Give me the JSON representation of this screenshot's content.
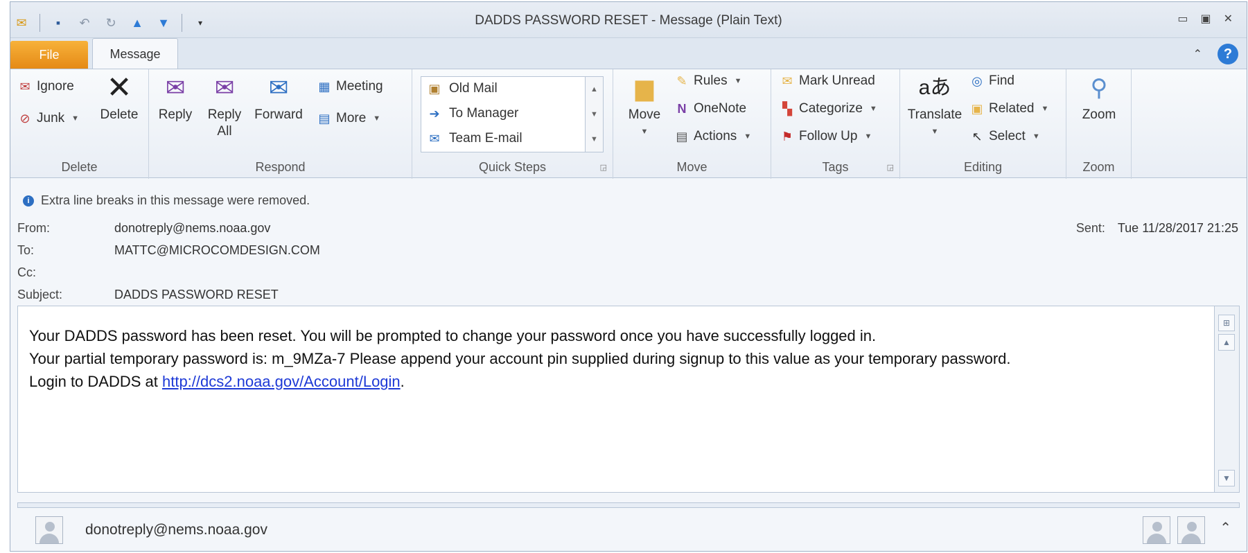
{
  "window": {
    "title": "DADDS PASSWORD RESET  -  Message (Plain Text)",
    "quick_access_icons": [
      "mail-icon",
      "save-icon",
      "undo-icon",
      "redo-icon",
      "previous-item-icon",
      "next-item-icon",
      "customize-qat-icon"
    ]
  },
  "tabs": {
    "file": "File",
    "message": "Message"
  },
  "ribbon": {
    "delete": {
      "label": "Delete",
      "ignore": "Ignore",
      "junk": "Junk",
      "delete_btn": "Delete"
    },
    "respond": {
      "label": "Respond",
      "reply": "Reply",
      "reply_all": "Reply\nAll",
      "forward": "Forward",
      "meeting": "Meeting",
      "more": "More"
    },
    "quick_steps": {
      "label": "Quick Steps",
      "items": [
        "Old Mail",
        "To Manager",
        "Team E-mail"
      ]
    },
    "move": {
      "label": "Move",
      "move_btn": "Move",
      "rules": "Rules",
      "onenote": "OneNote",
      "actions": "Actions"
    },
    "tags": {
      "label": "Tags",
      "mark_unread": "Mark Unread",
      "categorize": "Categorize",
      "follow_up": "Follow Up"
    },
    "editing": {
      "label": "Editing",
      "translate": "Translate",
      "find": "Find",
      "related": "Related",
      "select": "Select"
    },
    "zoom": {
      "label": "Zoom",
      "zoom_btn": "Zoom"
    }
  },
  "message": {
    "info": "Extra line breaks in this message were removed.",
    "from_label": "From:",
    "from": "donotreply@nems.noaa.gov",
    "to_label": "To:",
    "to": "MATTC@MICROCOMDESIGN.COM",
    "cc_label": "Cc:",
    "cc": "",
    "subject_label": "Subject:",
    "subject": "DADDS PASSWORD RESET",
    "sent_label": "Sent:",
    "sent": "Tue 11/28/2017 21:25",
    "body_line1": "Your DADDS password has been reset.  You will be prompted to change your password once you have successfully logged in.",
    "body_line2": "Your partial temporary password is: m_9MZa-7 Please append your account pin supplied during signup to this value as your temporary password.",
    "body_line3_prefix": "Login to DADDS at ",
    "body_link": "http://dcs2.noaa.gov/Account/Login",
    "body_line3_suffix": "."
  },
  "people_pane": {
    "name": "donotreply@nems.noaa.gov"
  },
  "colors": {
    "file_tab": "#e58a16",
    "link": "#1d39d6",
    "help": "#2d7bd6"
  }
}
